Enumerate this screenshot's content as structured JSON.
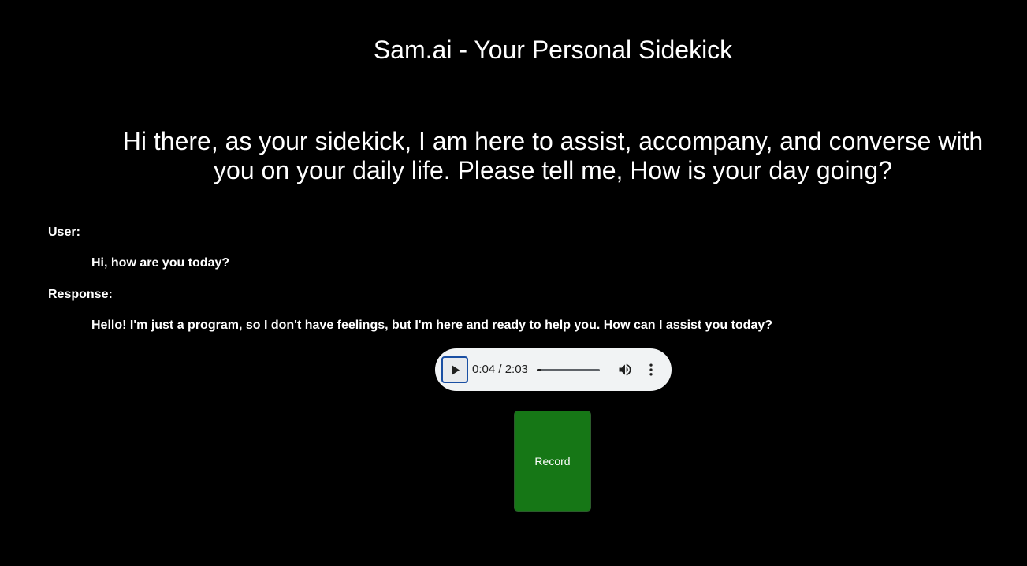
{
  "header": {
    "title": "Sam.ai - Your Personal Sidekick"
  },
  "greeting": "Hi there, as your sidekick, I am here to assist, accompany, and converse with you on your daily life. Please tell me, How is your day going?",
  "conversation": {
    "user_label": "User:",
    "user_text": "Hi, how are you today?",
    "response_label": "Response:",
    "response_text": "Hello! I'm just a program, so I don't have feelings, but I'm here and ready to help you. How can I assist you today?"
  },
  "audio": {
    "time": "0:04 / 2:03",
    "progress": 0.033,
    "play_icon": "play-icon",
    "volume_icon": "volume-icon",
    "menu_icon": "more-vert-icon"
  },
  "record_button": {
    "label": "Record",
    "color": "#167716"
  }
}
